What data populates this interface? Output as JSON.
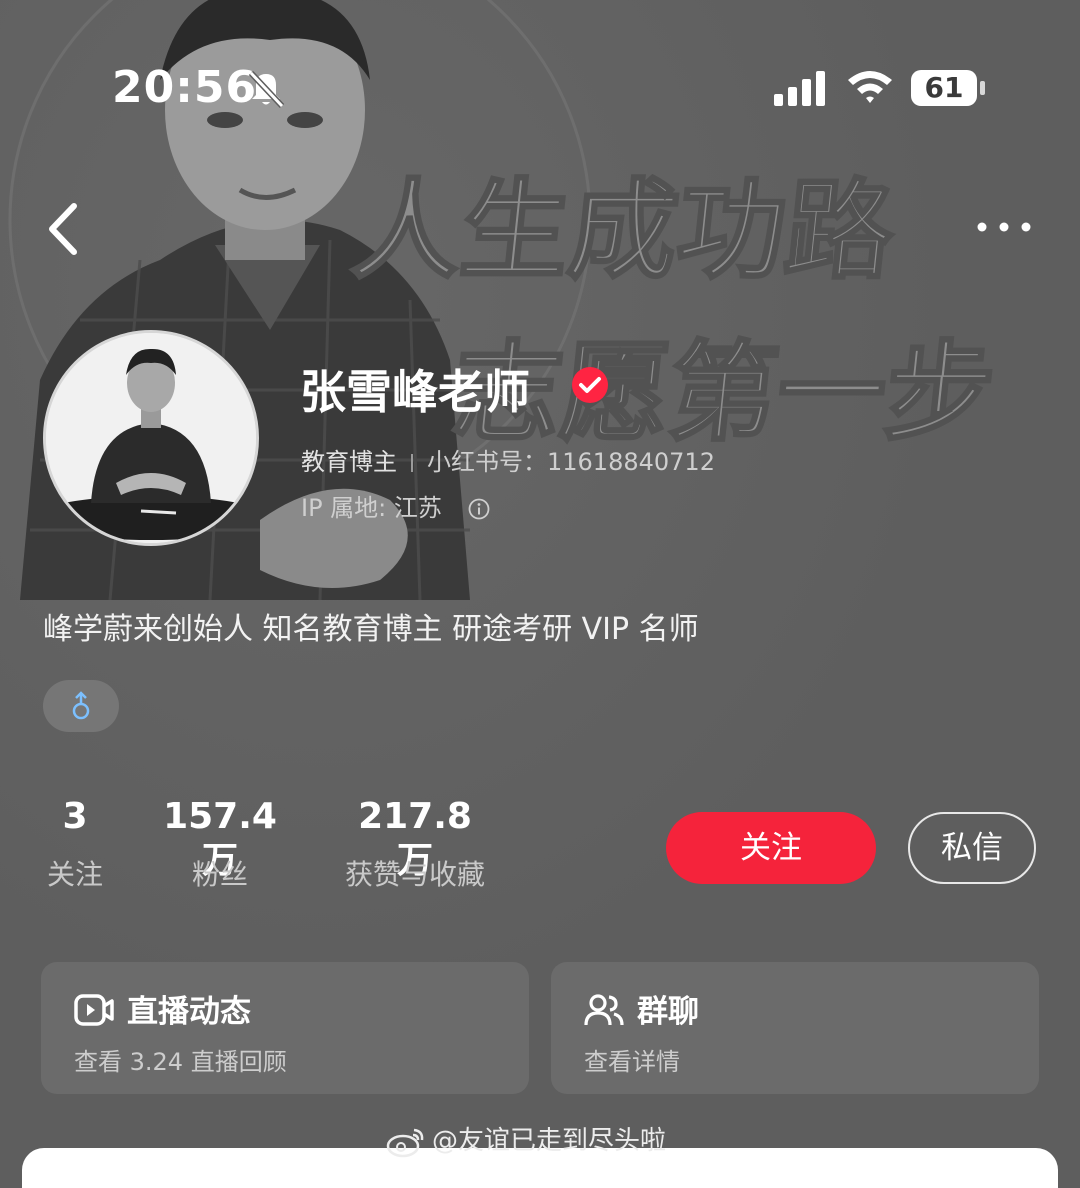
{
  "status_bar": {
    "time": "20:56",
    "battery": "61",
    "icons": [
      "bell-slash-icon",
      "signal-icon",
      "wifi-icon",
      "battery-icon"
    ]
  },
  "header": {
    "back_icon": "chevron-left-icon",
    "more_icon": "more-dots-icon"
  },
  "background": {
    "headline_line1": "人生成功路",
    "headline_line2": "志愿第一步"
  },
  "profile": {
    "name": "张雪峰老师",
    "verified_icon": "verified-badge-icon",
    "category": "教育博主",
    "id_label": "小红书号：",
    "id_value": "11618840712",
    "ip_label": "IP 属地: 江苏",
    "bio": "峰学蔚来创始人 知名教育博主 研途考研 VIP 名师",
    "gender_icon": "male-icon"
  },
  "stats": [
    {
      "num": "3",
      "label": "关注"
    },
    {
      "num": "157.4 万",
      "label": "粉丝"
    },
    {
      "num": "217.8 万",
      "label": "获赞与收藏"
    }
  ],
  "actions": {
    "follow": "关注",
    "message": "私信"
  },
  "cards": [
    {
      "title": "直播动态",
      "sub": "查看 3.24 直播回顾",
      "icon": "live-video-icon"
    },
    {
      "title": "群聊",
      "sub": "查看详情",
      "icon": "group-chat-icon"
    }
  ],
  "watermark": "@友谊已走到尽头啦",
  "colors": {
    "accent": "#f5233b",
    "verified": "#ff2442",
    "background": "#5e5e5e",
    "card": "#6b6b6b"
  }
}
